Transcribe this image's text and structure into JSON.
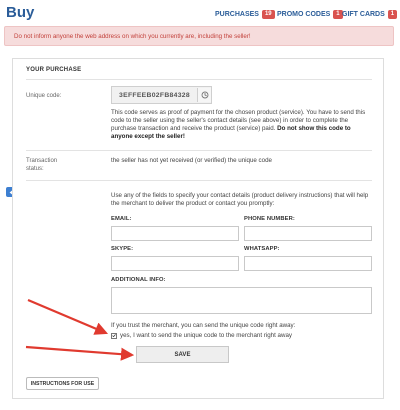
{
  "header": {
    "title": "Buy",
    "nav": [
      {
        "label": "PURCHASES",
        "count": "19"
      },
      {
        "label": "PROMO CODES",
        "count": "1"
      },
      {
        "label": "GIFT CARDS",
        "count": "1"
      }
    ]
  },
  "alert": {
    "text": "Do not inform anyone the web address on which you currently are, including the seller!"
  },
  "purchase": {
    "section_title": "YOUR PURCHASE",
    "unique_code_label": "Unique code:",
    "unique_code": "3EFFEEB02FB84328",
    "description_part1": "This code serves as proof of payment for the chosen product (service). You have to send this code to the seller using the seller's contact details (see above) in order to complete the purchase transaction and receive the product (service) paid.",
    "description_bold": "Do not show this code to anyone except the seller!",
    "status_label": "Transaction status:",
    "status_text": "the seller has not yet received (or verified) the unique code"
  },
  "contact": {
    "description": "Use any of the fields to specify your contact details (product delivery instructions) that will help the merchant to deliver the product or contact you promptly:",
    "email_label": "EMAIL:",
    "email_value": "",
    "phone_label": "PHONE NUMBER:",
    "phone_value": "",
    "skype_label": "SKYPE:",
    "skype_value": "",
    "whatsapp_label": "WHATSAPP:",
    "whatsapp_value": "",
    "additional_label": "ADDITIONAL INFO:",
    "additional_value": ""
  },
  "consent": {
    "trust_text": "If you trust the merchant, you can send the unique code right away:",
    "checkbox_label": "yes, I want to send the unique code to the merchant right away",
    "checked": true
  },
  "buttons": {
    "save": "SAVE",
    "instructions": "INSTRUCTIONS FOR USE"
  },
  "colors": {
    "accent": "#2b5d99",
    "badge": "#d9534f",
    "alert_bg": "#f6dcdc",
    "alert_text": "#c2413b",
    "annotation_arrow": "#e03a2f"
  }
}
